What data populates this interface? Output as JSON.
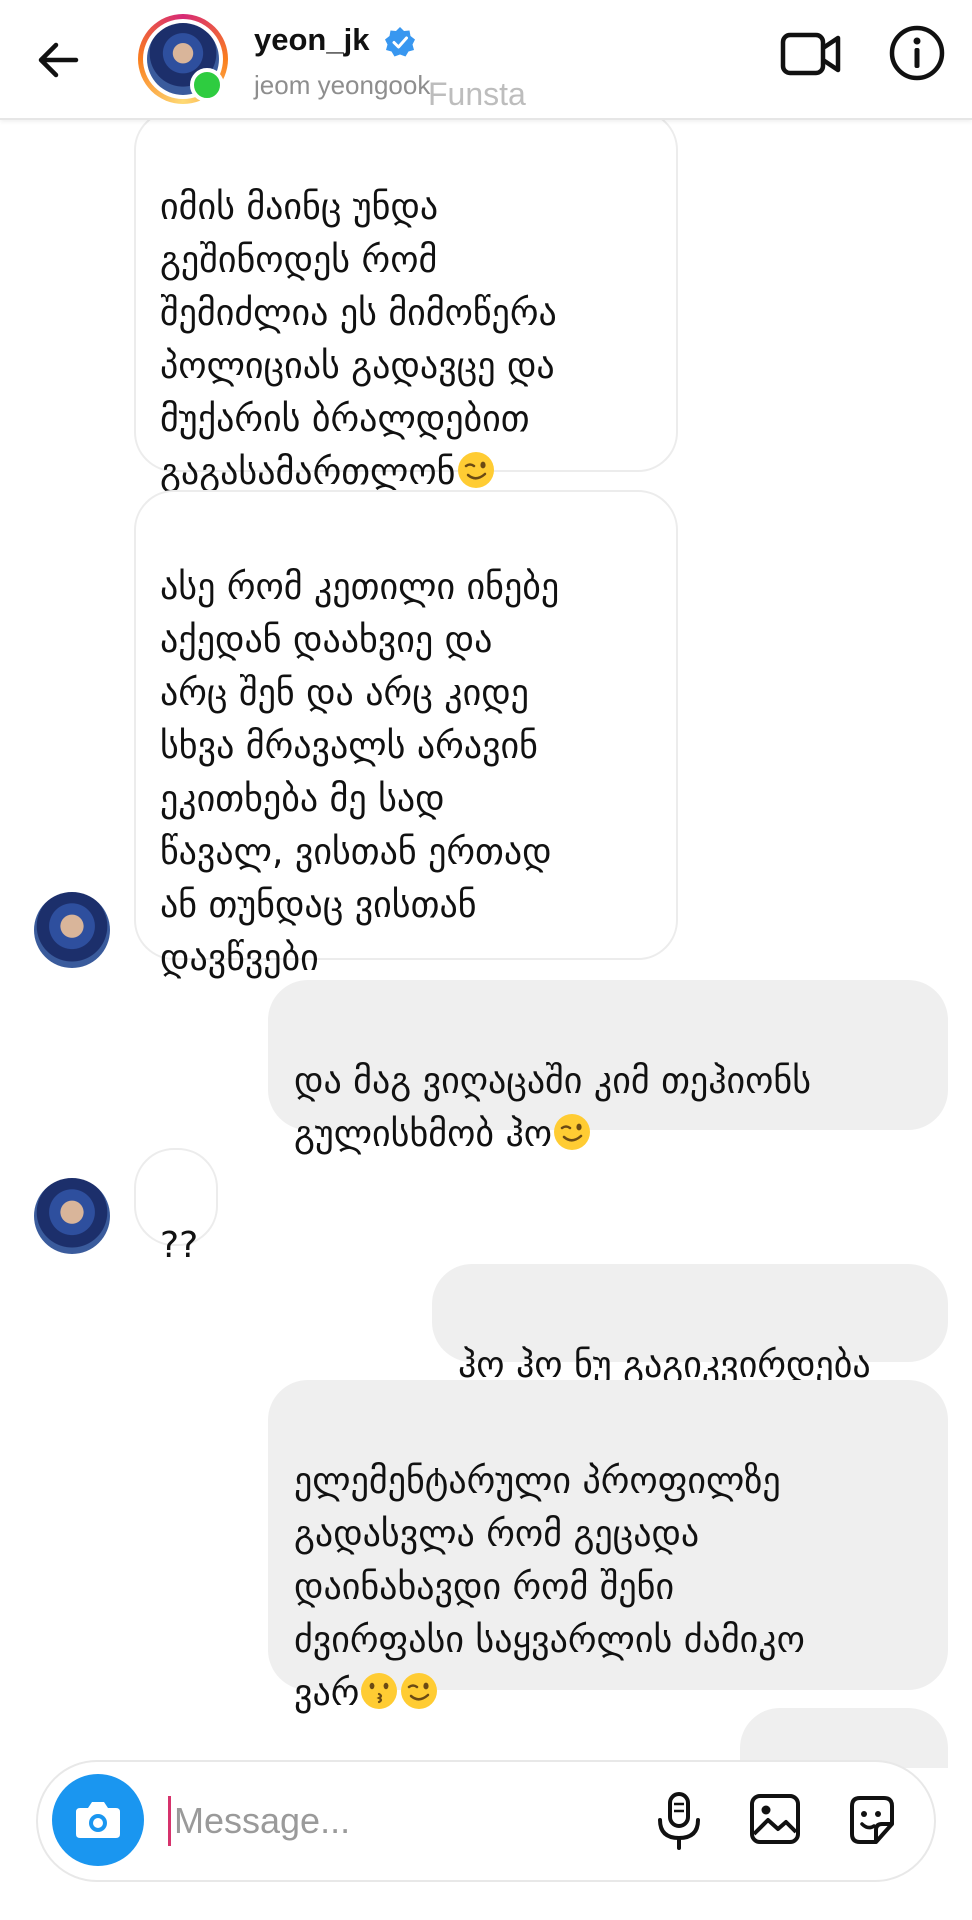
{
  "header": {
    "username": "yeon_jk",
    "fullname": "jeom yeongook",
    "watermark": "Funsta"
  },
  "messages": [
    {
      "direction": "in",
      "text": "იმის მაინც უნდა\nგეშინოდეს რომ\nშემიძლია ეს მიმოწერა\nპოლიციას გადავცე და\nმუქარის ბრალდებით\nგაგასამართლონ",
      "emoji": "wink"
    },
    {
      "direction": "in",
      "text": "ასე რომ კეთილი ინებე\nაქედან დაახვიე და\nარც შენ და არც კიდე\nსხვა მრავალს არავინ\nეკითხება მე სად\nწავალ, ვისთან ერთად\nან თუნდაც ვისთან\nდავწვები"
    },
    {
      "direction": "out",
      "text": "და მაგ ვიღაცაში კიმ თეჰიონს\nგულისხმობ ჰო",
      "emoji": "wink"
    },
    {
      "direction": "in",
      "text": "??"
    },
    {
      "direction": "out",
      "text": "ჰო ჰო ნუ გაგიკვირდება"
    },
    {
      "direction": "out",
      "text": "ელემენტარული პროფილზე\nგადასვლა რომ გეცადა\nდაინახავდი რომ შენი\nძვირფასი საყვარლის ძამიკო\nვარ",
      "emoji": "kiss-wink"
    }
  ],
  "composer": {
    "placeholder": "Message..."
  },
  "icons": {
    "back": "arrow-left-icon",
    "verified": "verified-badge-icon",
    "video": "video-call-icon",
    "info": "info-icon",
    "camera": "camera-icon",
    "mic": "microphone-icon",
    "gallery": "image-gallery-icon",
    "sticker": "sticker-icon"
  },
  "colors": {
    "accent": "#1a96f0",
    "online": "#2ecc40",
    "outgoing_bubble": "#efefef"
  }
}
